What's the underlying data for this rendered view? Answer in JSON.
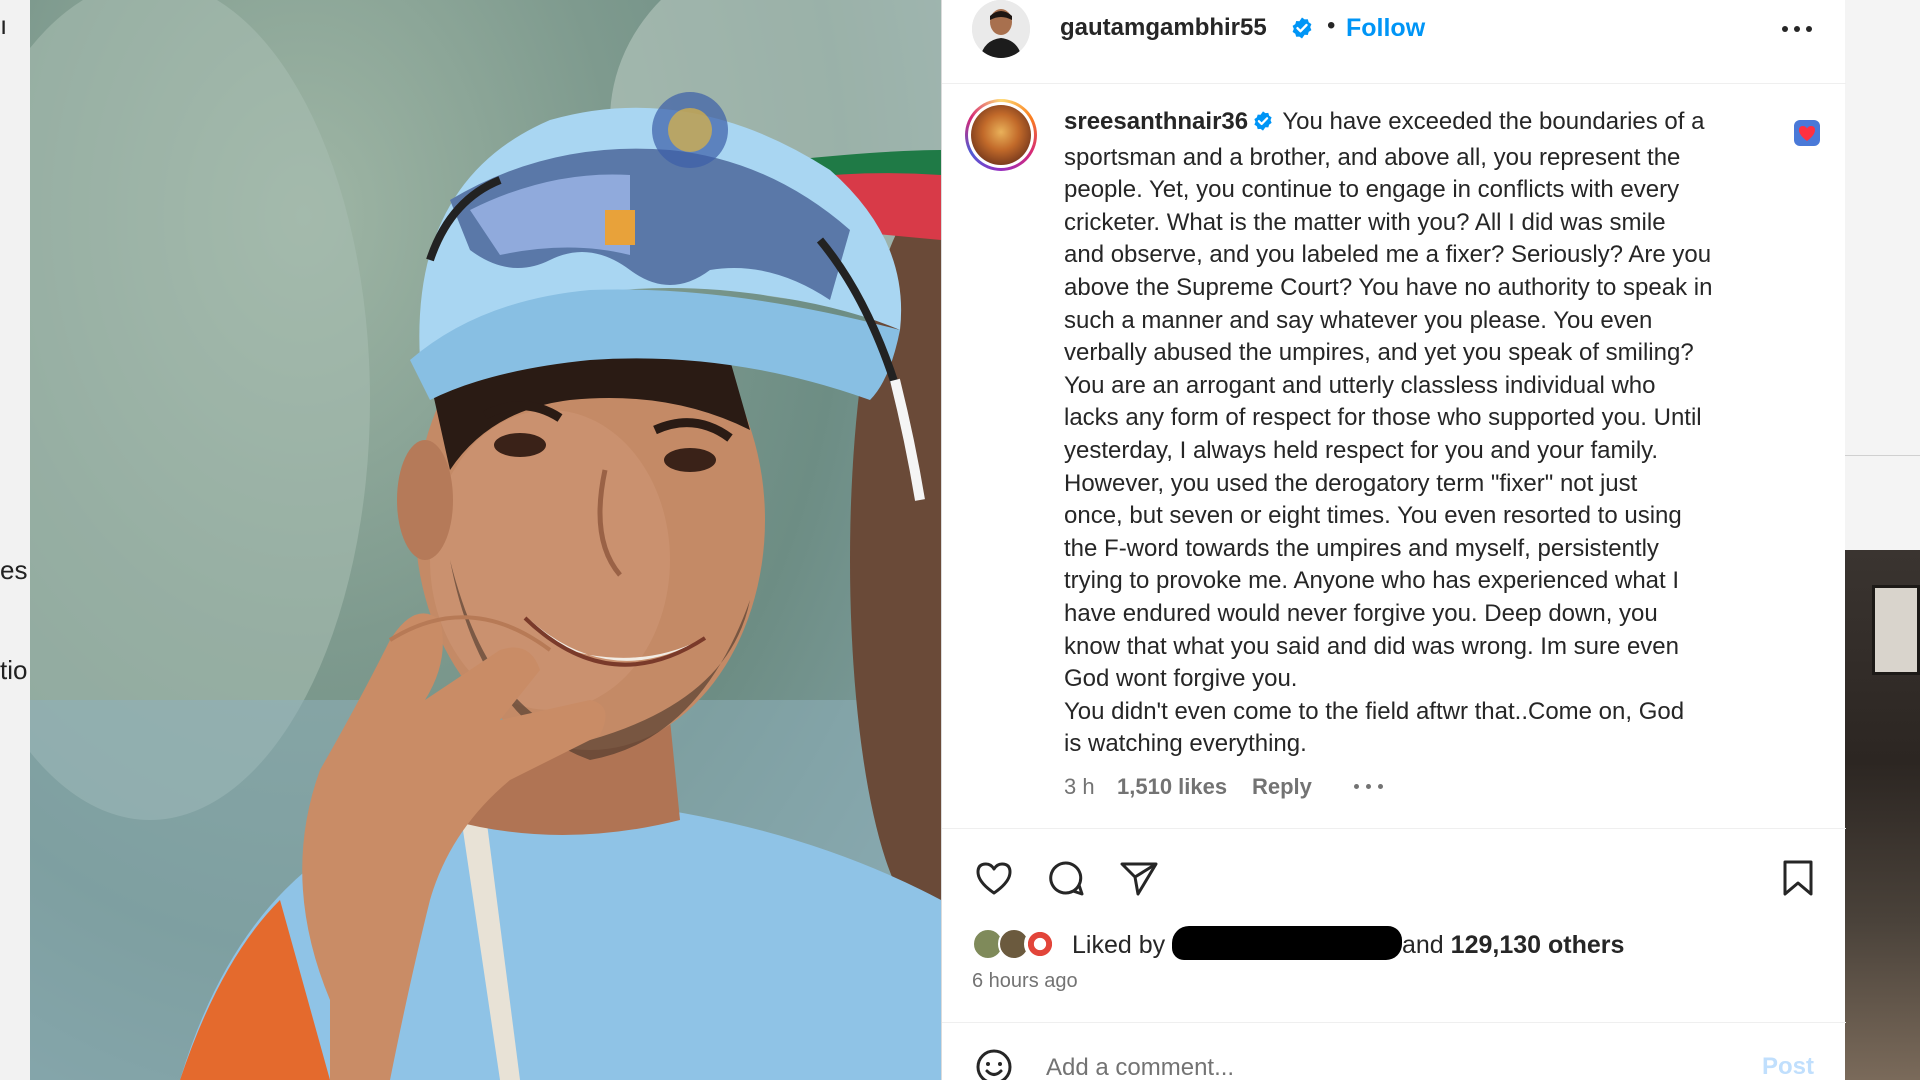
{
  "backdrop": {
    "left_snippets": [
      "ı",
      "es",
      "tio"
    ]
  },
  "post": {
    "author": {
      "username": "gautamgambhir55",
      "verified": true,
      "separator": "•",
      "follow_label": "Follow"
    },
    "comment": {
      "username": "sreesanthnair36",
      "verified": true,
      "lines": [
        "You have exceeded the boundaries of a",
        "sportsman and a brother, and above all, you represent the",
        "people. Yet, you continue to engage in conflicts with every",
        "cricketer. What is the matter with you? All I did was smile",
        "and observe, and you labeled me a fixer? Seriously? Are you",
        "above the Supreme Court? You have no authority to speak in",
        "such a manner and say whatever you please. You even",
        "verbally abused the umpires, and yet you speak of smiling?",
        "You are an arrogant and utterly classless individual who",
        "lacks any form of respect for those who supported you. Until",
        "yesterday, I always held respect for you and your family.",
        "However, you used the derogatory term \"fixer\" not just",
        "once, but seven or eight times. You even resorted to using",
        "the F-word towards the umpires and myself, persistently",
        "trying to provoke me. Anyone who has experienced what I",
        "have endured would never forgive you. Deep down, you",
        "know that what you said and did was wrong. Im sure even",
        "God wont forgive you.",
        "You didn't even come to the field aftwr that..Come on, God",
        "is watching everything."
      ],
      "age": "3 h",
      "likes": "1,510 likes",
      "reply_label": "Reply"
    },
    "likes": {
      "liked_by_label": "Liked by",
      "and_label": "and",
      "others_count": "129,130 others"
    },
    "posted_ago": "6 hours ago",
    "add_comment": {
      "placeholder": "Add a comment...",
      "post_label": "Post"
    }
  },
  "icons": {
    "header_more": "more-horizontal-icon",
    "verified": "verified-badge-icon",
    "comment_like": "heart-badge-icon",
    "like": "heart-outline-icon",
    "comment": "comment-bubble-icon",
    "share": "paper-plane-icon",
    "save": "bookmark-icon",
    "emoji": "smiley-icon"
  },
  "colors": {
    "accent": "#0095f6",
    "post_disabled": "#c0dffd",
    "verified": "#0095f6",
    "text": "#262626",
    "muted": "#737373"
  }
}
